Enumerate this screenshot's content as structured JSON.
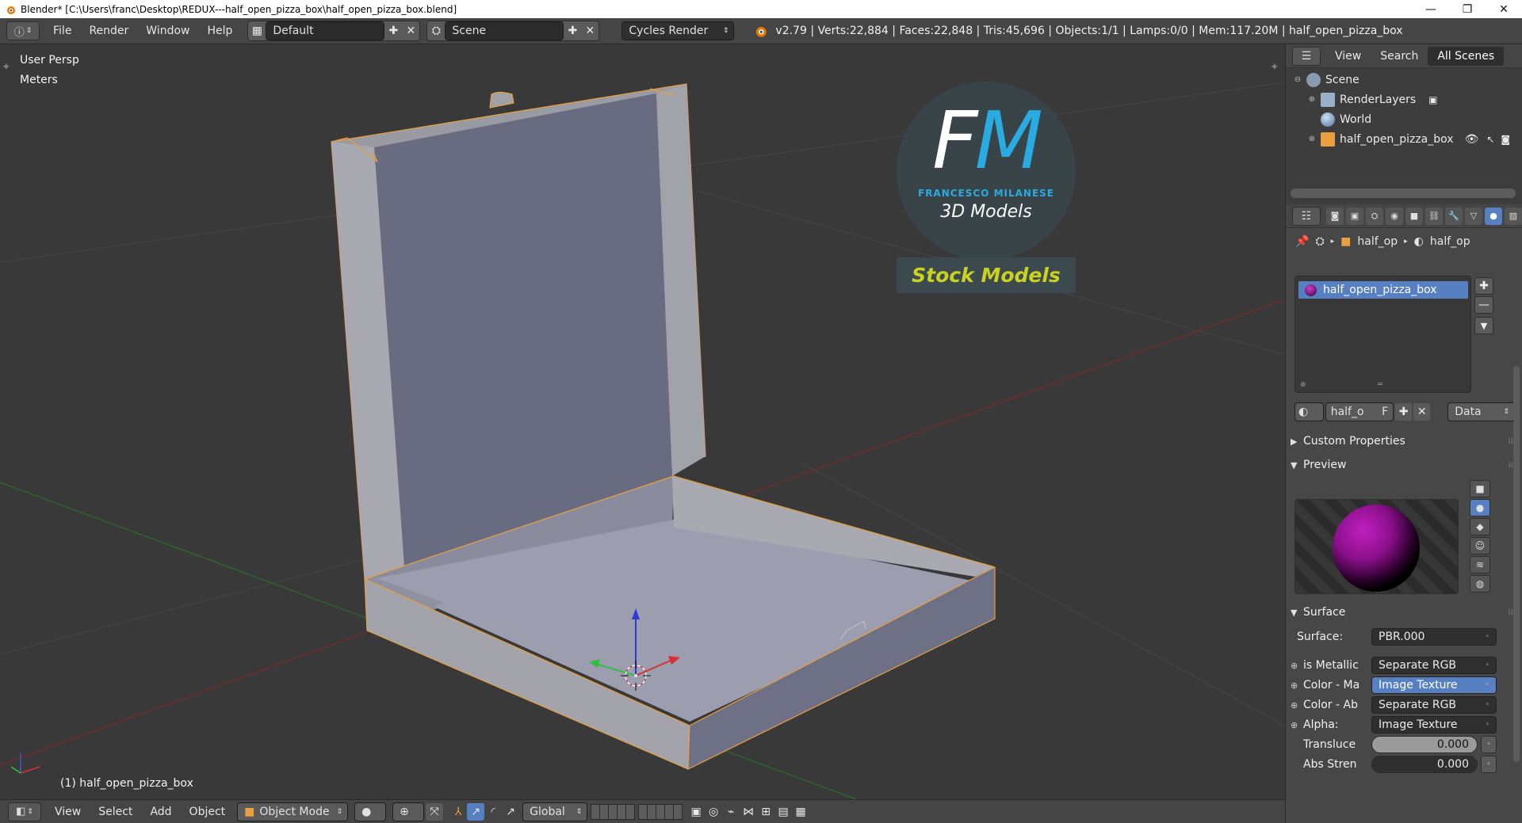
{
  "window": {
    "title": "Blender* [C:\\Users\\franc\\Desktop\\REDUX---half_open_pizza_box\\half_open_pizza_box.blend]",
    "minimize": "—",
    "maximize": "❐",
    "close": "✕"
  },
  "infobar": {
    "menus": [
      "File",
      "Render",
      "Window",
      "Help"
    ],
    "layout": "Default",
    "scene": "Scene",
    "engine": "Cycles Render",
    "stats": "v2.79 | Verts:22,884 | Faces:22,848 | Tris:45,696 | Objects:1/1 | Lamps:0/0 | Mem:117.20M | half_open_pizza_box"
  },
  "viewport": {
    "view_name": "User Persp",
    "units": "Meters",
    "active_object": "(1) half_open_pizza_box"
  },
  "watermark": {
    "logo_f": "F",
    "logo_m": "M",
    "author": "FRANCESCO MILANESE",
    "subtitle": "3D Models",
    "banner": "Stock Models"
  },
  "bottombar": {
    "menus": [
      "View",
      "Select",
      "Add",
      "Object"
    ],
    "mode": "Object Mode",
    "orientation": "Global"
  },
  "outliner": {
    "tabs": [
      "View",
      "Search",
      "All Scenes"
    ],
    "items": [
      {
        "label": "Scene"
      },
      {
        "label": "RenderLayers"
      },
      {
        "label": "World"
      },
      {
        "label": "half_open_pizza_box"
      }
    ]
  },
  "properties": {
    "breadcrumb": [
      "half_op",
      "half_op"
    ],
    "material_slot": "half_open_pizza_box",
    "material_name": "half_o",
    "fake_user": "F",
    "link": "Data",
    "panels": {
      "custom_properties": "Custom Properties",
      "preview": "Preview",
      "surface": "Surface"
    },
    "surface_rows": [
      {
        "label": "Surface:",
        "value": "PBR.000"
      },
      {
        "label": "is Metallic",
        "value": "Separate RGB"
      },
      {
        "label": "Color - Ma",
        "value": "Image Texture"
      },
      {
        "label": "Color - Ab",
        "value": "Separate RGB"
      },
      {
        "label": "Alpha:",
        "value": "Image Texture"
      }
    ],
    "numeric_rows": [
      {
        "label": "Transluce",
        "value": "0.000"
      },
      {
        "label": "Abs Stren",
        "value": "0.000"
      }
    ]
  },
  "colors": {
    "accent": "#5680c2",
    "viewport_bg": "#393939",
    "box_outline": "#e8a040",
    "logo_blue": "#29abe2",
    "banner_yellow": "#c9d21d"
  }
}
